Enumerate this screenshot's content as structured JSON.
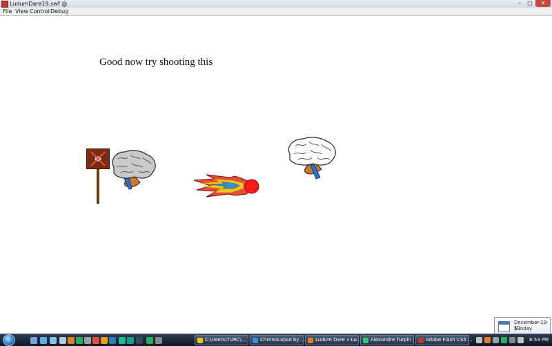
{
  "window": {
    "title": "LudumDare19.swf @",
    "close": "✕",
    "minimize": "–",
    "maximize": "□"
  },
  "menu": [
    "File",
    "View",
    "Control",
    "Debug"
  ],
  "stage": {
    "message": "Good now try shooting this"
  },
  "taskbar": {
    "tasks": [
      {
        "label": "C:\\Users\\TURC\\...",
        "icon_color": "#f1c40f"
      },
      {
        "label": "ChronoLapse by ...",
        "icon_color": "#3a8fd8"
      },
      {
        "label": "Ludum Dare » Lu...",
        "icon_color": "#e67e22"
      },
      {
        "label": "Alexandre Turpin",
        "icon_color": "#2ecc71"
      },
      {
        "label": "Adobe Flash CS5 ...",
        "icon_color": "#c0392b"
      }
    ],
    "clock": "8:53 PM"
  },
  "tooltip": {
    "date": "December-19-10",
    "day": "Sunday"
  }
}
